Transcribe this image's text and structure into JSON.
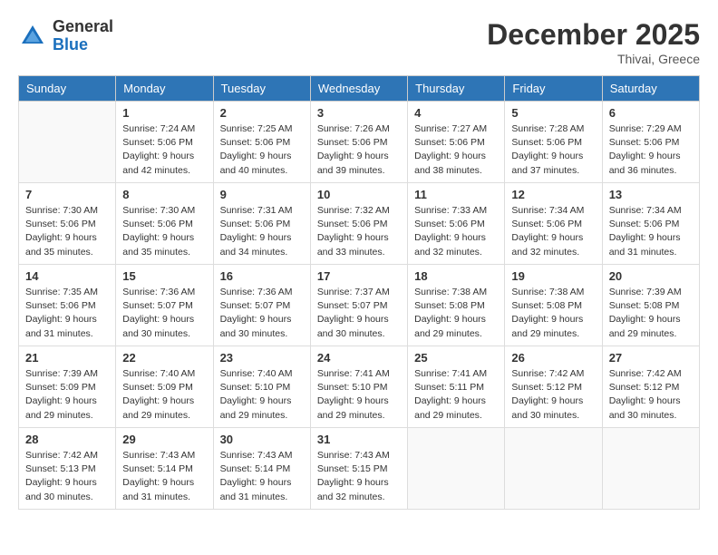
{
  "header": {
    "logo_general": "General",
    "logo_blue": "Blue",
    "month_year": "December 2025",
    "location": "Thivai, Greece"
  },
  "columns": [
    "Sunday",
    "Monday",
    "Tuesday",
    "Wednesday",
    "Thursday",
    "Friday",
    "Saturday"
  ],
  "weeks": [
    [
      {
        "day": "",
        "info": ""
      },
      {
        "day": "1",
        "info": "Sunrise: 7:24 AM\nSunset: 5:06 PM\nDaylight: 9 hours\nand 42 minutes."
      },
      {
        "day": "2",
        "info": "Sunrise: 7:25 AM\nSunset: 5:06 PM\nDaylight: 9 hours\nand 40 minutes."
      },
      {
        "day": "3",
        "info": "Sunrise: 7:26 AM\nSunset: 5:06 PM\nDaylight: 9 hours\nand 39 minutes."
      },
      {
        "day": "4",
        "info": "Sunrise: 7:27 AM\nSunset: 5:06 PM\nDaylight: 9 hours\nand 38 minutes."
      },
      {
        "day": "5",
        "info": "Sunrise: 7:28 AM\nSunset: 5:06 PM\nDaylight: 9 hours\nand 37 minutes."
      },
      {
        "day": "6",
        "info": "Sunrise: 7:29 AM\nSunset: 5:06 PM\nDaylight: 9 hours\nand 36 minutes."
      }
    ],
    [
      {
        "day": "7",
        "info": "Sunrise: 7:30 AM\nSunset: 5:06 PM\nDaylight: 9 hours\nand 35 minutes."
      },
      {
        "day": "8",
        "info": "Sunrise: 7:30 AM\nSunset: 5:06 PM\nDaylight: 9 hours\nand 35 minutes."
      },
      {
        "day": "9",
        "info": "Sunrise: 7:31 AM\nSunset: 5:06 PM\nDaylight: 9 hours\nand 34 minutes."
      },
      {
        "day": "10",
        "info": "Sunrise: 7:32 AM\nSunset: 5:06 PM\nDaylight: 9 hours\nand 33 minutes."
      },
      {
        "day": "11",
        "info": "Sunrise: 7:33 AM\nSunset: 5:06 PM\nDaylight: 9 hours\nand 32 minutes."
      },
      {
        "day": "12",
        "info": "Sunrise: 7:34 AM\nSunset: 5:06 PM\nDaylight: 9 hours\nand 32 minutes."
      },
      {
        "day": "13",
        "info": "Sunrise: 7:34 AM\nSunset: 5:06 PM\nDaylight: 9 hours\nand 31 minutes."
      }
    ],
    [
      {
        "day": "14",
        "info": "Sunrise: 7:35 AM\nSunset: 5:06 PM\nDaylight: 9 hours\nand 31 minutes."
      },
      {
        "day": "15",
        "info": "Sunrise: 7:36 AM\nSunset: 5:07 PM\nDaylight: 9 hours\nand 30 minutes."
      },
      {
        "day": "16",
        "info": "Sunrise: 7:36 AM\nSunset: 5:07 PM\nDaylight: 9 hours\nand 30 minutes."
      },
      {
        "day": "17",
        "info": "Sunrise: 7:37 AM\nSunset: 5:07 PM\nDaylight: 9 hours\nand 30 minutes."
      },
      {
        "day": "18",
        "info": "Sunrise: 7:38 AM\nSunset: 5:08 PM\nDaylight: 9 hours\nand 29 minutes."
      },
      {
        "day": "19",
        "info": "Sunrise: 7:38 AM\nSunset: 5:08 PM\nDaylight: 9 hours\nand 29 minutes."
      },
      {
        "day": "20",
        "info": "Sunrise: 7:39 AM\nSunset: 5:08 PM\nDaylight: 9 hours\nand 29 minutes."
      }
    ],
    [
      {
        "day": "21",
        "info": "Sunrise: 7:39 AM\nSunset: 5:09 PM\nDaylight: 9 hours\nand 29 minutes."
      },
      {
        "day": "22",
        "info": "Sunrise: 7:40 AM\nSunset: 5:09 PM\nDaylight: 9 hours\nand 29 minutes."
      },
      {
        "day": "23",
        "info": "Sunrise: 7:40 AM\nSunset: 5:10 PM\nDaylight: 9 hours\nand 29 minutes."
      },
      {
        "day": "24",
        "info": "Sunrise: 7:41 AM\nSunset: 5:10 PM\nDaylight: 9 hours\nand 29 minutes."
      },
      {
        "day": "25",
        "info": "Sunrise: 7:41 AM\nSunset: 5:11 PM\nDaylight: 9 hours\nand 29 minutes."
      },
      {
        "day": "26",
        "info": "Sunrise: 7:42 AM\nSunset: 5:12 PM\nDaylight: 9 hours\nand 30 minutes."
      },
      {
        "day": "27",
        "info": "Sunrise: 7:42 AM\nSunset: 5:12 PM\nDaylight: 9 hours\nand 30 minutes."
      }
    ],
    [
      {
        "day": "28",
        "info": "Sunrise: 7:42 AM\nSunset: 5:13 PM\nDaylight: 9 hours\nand 30 minutes."
      },
      {
        "day": "29",
        "info": "Sunrise: 7:43 AM\nSunset: 5:14 PM\nDaylight: 9 hours\nand 31 minutes."
      },
      {
        "day": "30",
        "info": "Sunrise: 7:43 AM\nSunset: 5:14 PM\nDaylight: 9 hours\nand 31 minutes."
      },
      {
        "day": "31",
        "info": "Sunrise: 7:43 AM\nSunset: 5:15 PM\nDaylight: 9 hours\nand 32 minutes."
      },
      {
        "day": "",
        "info": ""
      },
      {
        "day": "",
        "info": ""
      },
      {
        "day": "",
        "info": ""
      }
    ]
  ]
}
